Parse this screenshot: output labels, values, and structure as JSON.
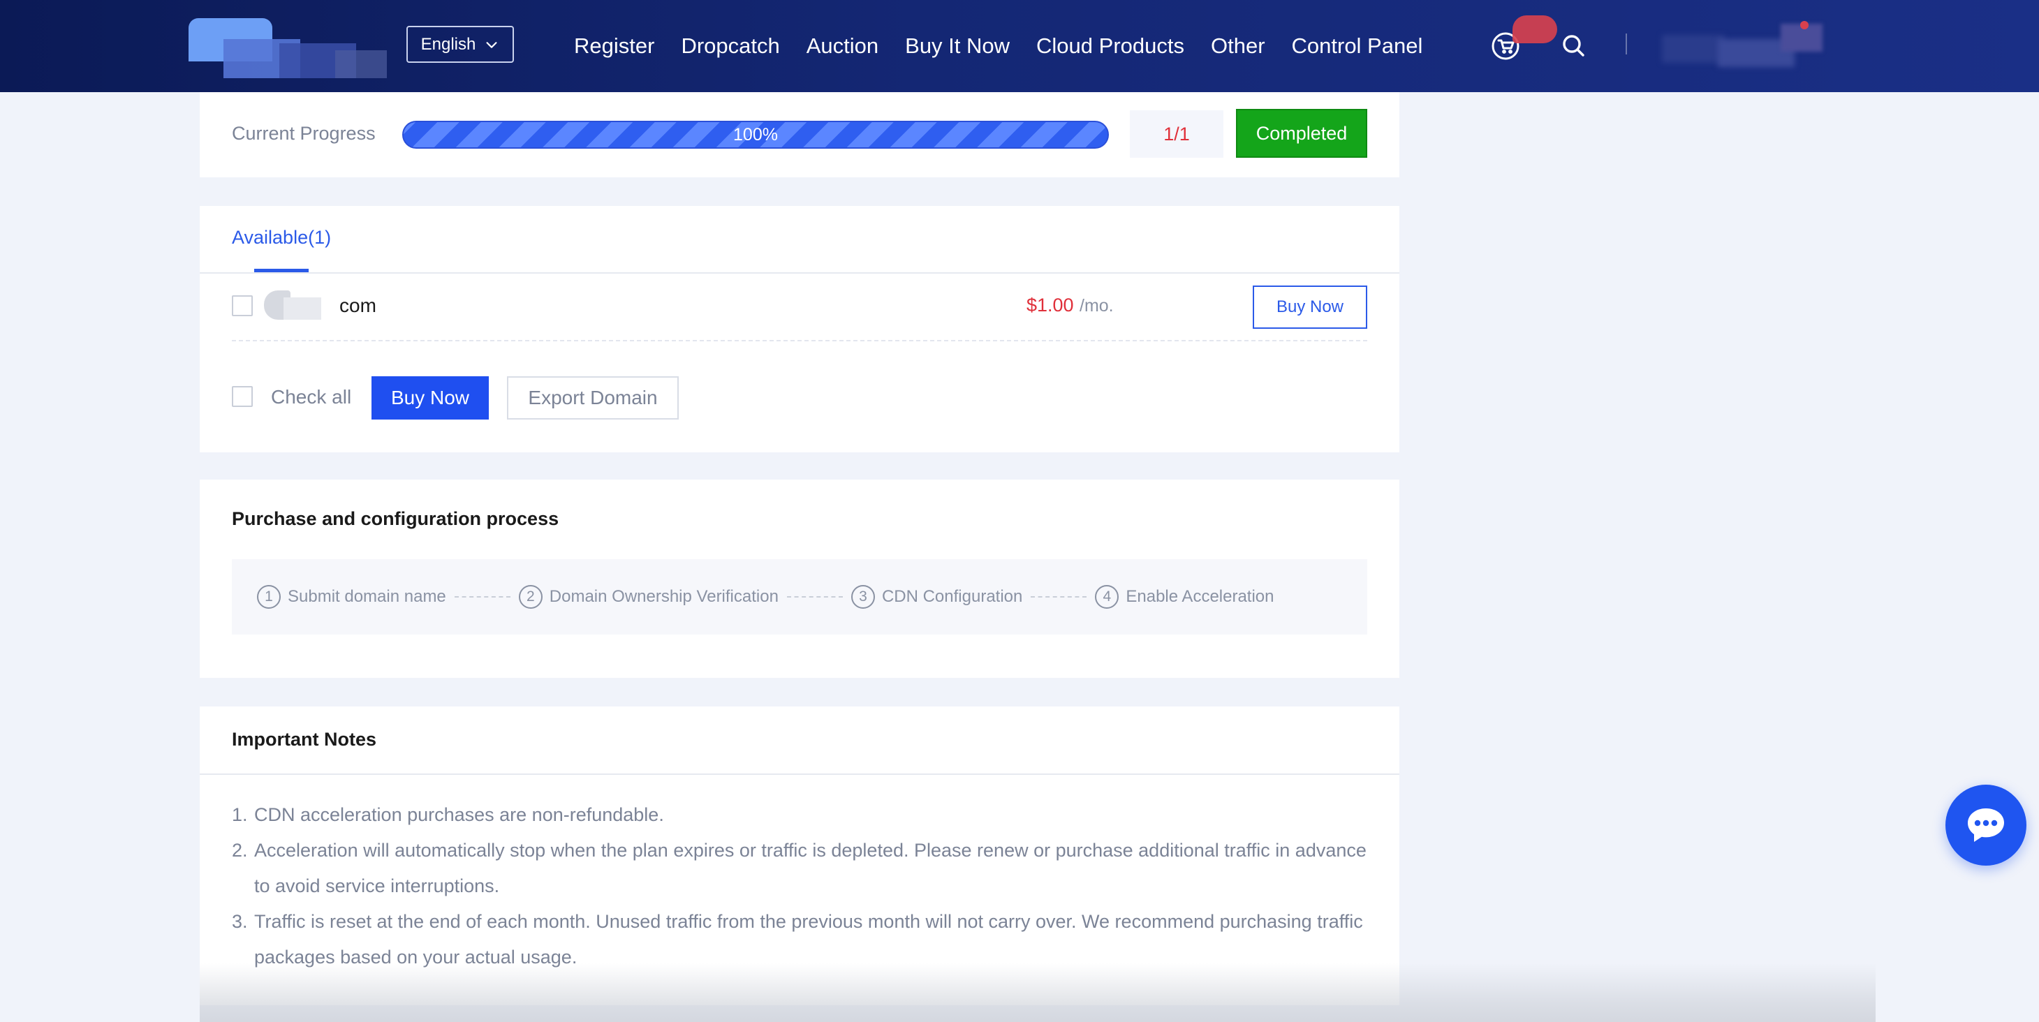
{
  "header": {
    "language": "English",
    "nav": [
      "Register",
      "Dropcatch",
      "Auction",
      "Buy It Now",
      "Cloud Products",
      "Other",
      "Control Panel"
    ]
  },
  "progress": {
    "label": "Current Progress",
    "percent_text": "100%",
    "percent": 100,
    "count": "1/1",
    "status": "Completed"
  },
  "results": {
    "tab_label": "Available(1)",
    "rows": [
      {
        "domain": "com",
        "price": "$1.00",
        "period": "/mo.",
        "action": "Buy Now"
      }
    ],
    "check_all": "Check all",
    "buy_now": "Buy Now",
    "export": "Export Domain"
  },
  "process": {
    "title": "Purchase and configuration process",
    "steps": [
      {
        "num": "1",
        "label": "Submit domain name"
      },
      {
        "num": "2",
        "label": "Domain Ownership Verification"
      },
      {
        "num": "3",
        "label": "CDN Configuration"
      },
      {
        "num": "4",
        "label": "Enable Acceleration"
      }
    ]
  },
  "notes": {
    "title": "Important Notes",
    "items": [
      {
        "num": "1.",
        "text": "CDN acceleration purchases are non-refundable."
      },
      {
        "num": "2.",
        "text": "Acceleration will automatically stop when the plan expires or traffic is depleted. Please renew or purchase additional traffic in advance to avoid service interruptions."
      },
      {
        "num": "3.",
        "text": "Traffic is reset at the end of each month. Unused traffic from the previous month will not carry over. We recommend purchasing traffic packages based on your actual usage."
      }
    ]
  },
  "icons": {
    "cart": "cart-icon",
    "search": "search-icon",
    "chat": "chat-icon",
    "chevron": "chevron-down-icon"
  },
  "colors": {
    "header_bg": "#142774",
    "accent": "#2b5ae8",
    "success": "#14a51a",
    "price": "#e0303a"
  }
}
